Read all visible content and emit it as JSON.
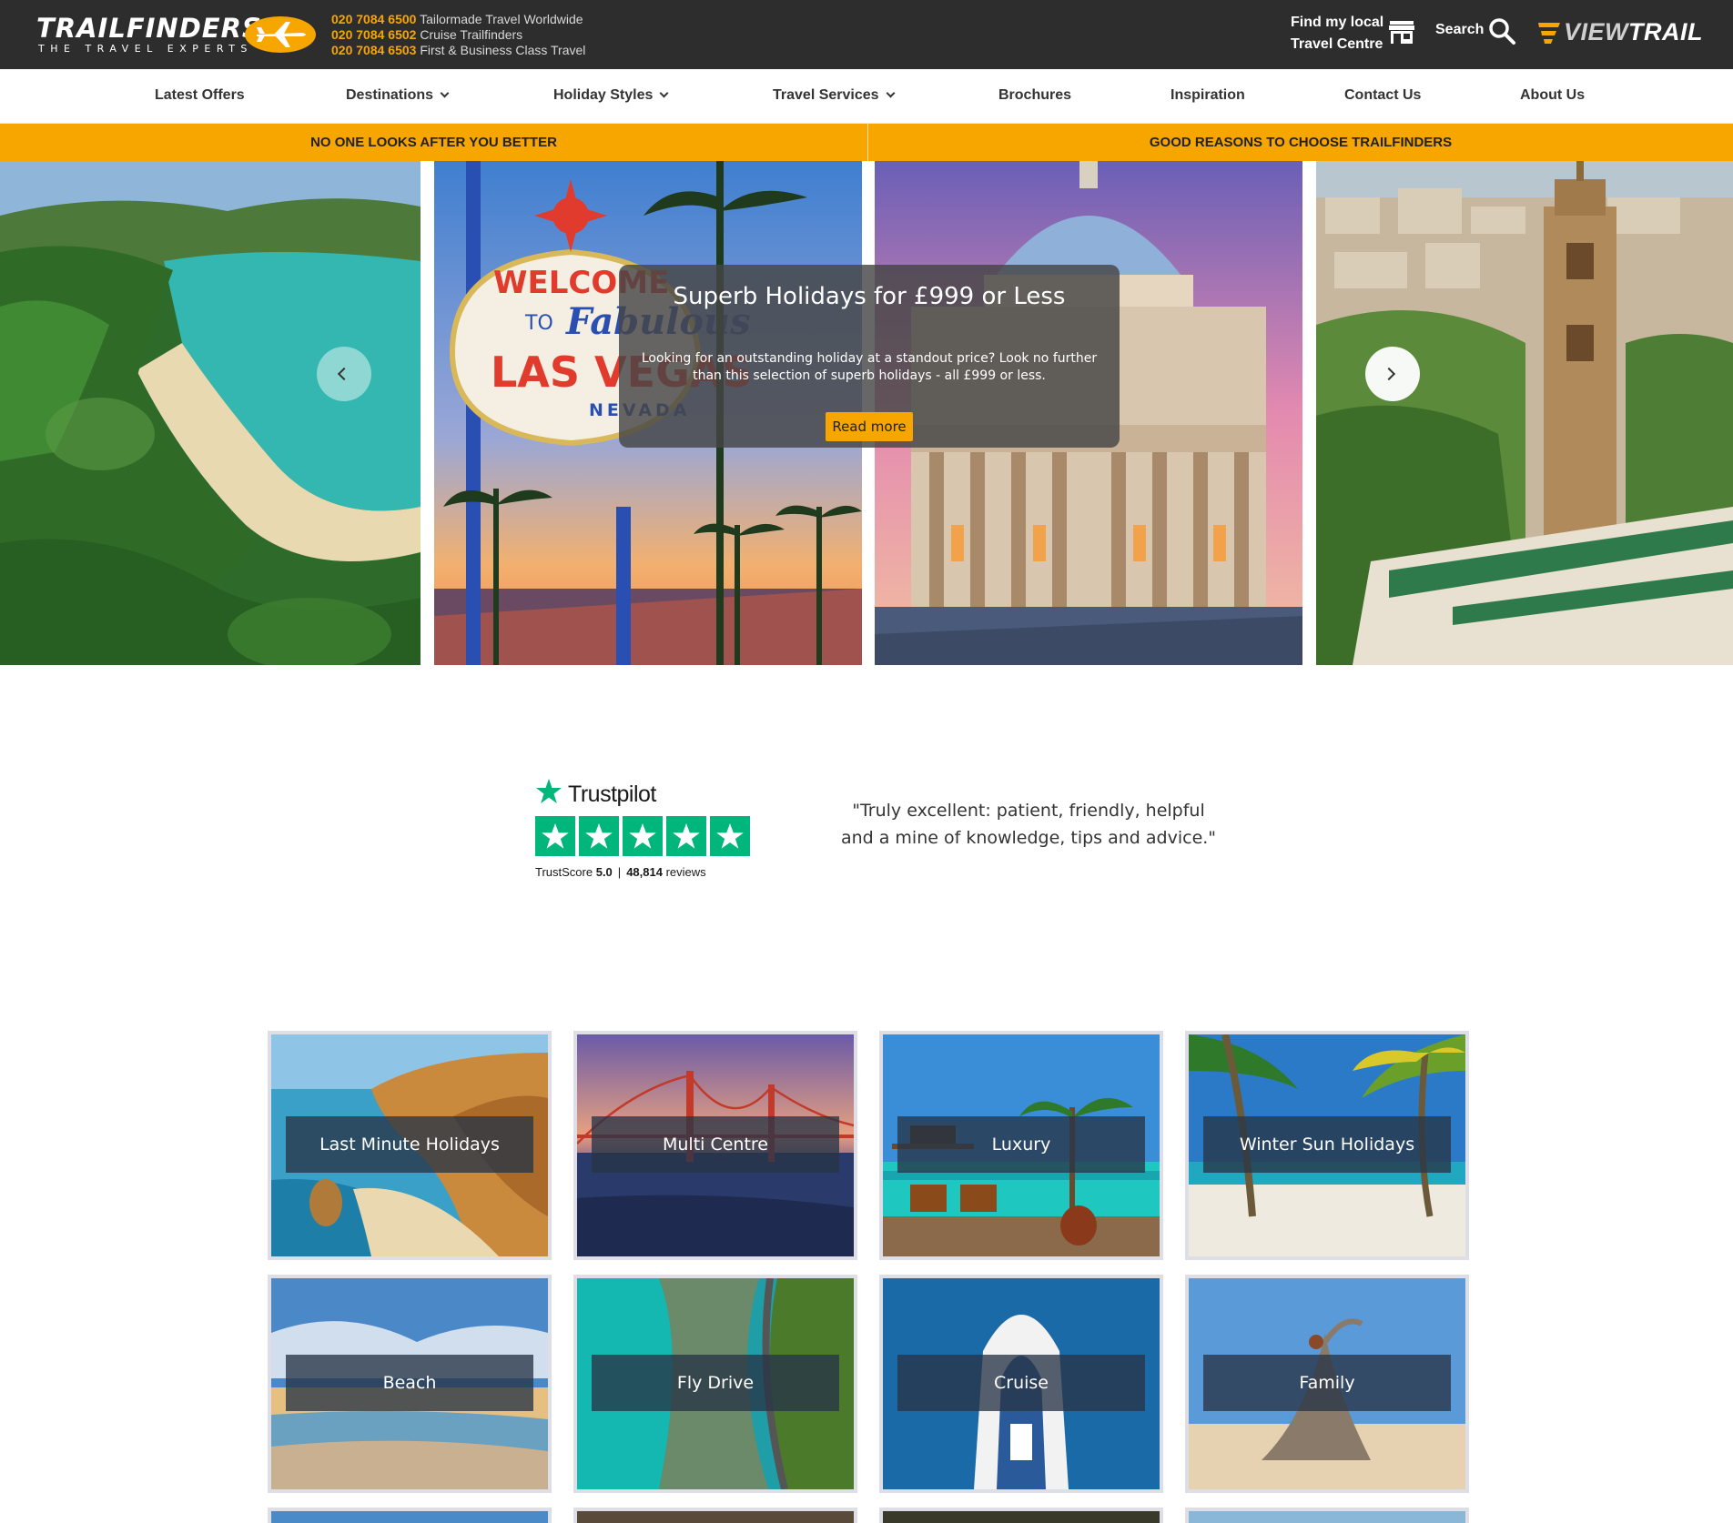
{
  "header": {
    "logo_word": "TRAILFINDERS",
    "logo_tagline": "THE TRAVEL EXPERTS",
    "phones": [
      {
        "number": "020 7084 6500",
        "label": "Tailormade Travel Worldwide"
      },
      {
        "number": "020 7084 6502",
        "label": "Cruise Trailfinders"
      },
      {
        "number": "020 7084 6503",
        "label": "First & Business Class Travel"
      }
    ],
    "find_centre_line1": "Find my local",
    "find_centre_line2": "Travel Centre",
    "search_label": "Search",
    "viewtrail_v": "VIEW",
    "viewtrail_rest": "TRAIL"
  },
  "nav": {
    "items": [
      {
        "label": "Latest Offers",
        "dropdown": false
      },
      {
        "label": "Destinations",
        "dropdown": true
      },
      {
        "label": "Holiday Styles",
        "dropdown": true
      },
      {
        "label": "Travel Services",
        "dropdown": true
      },
      {
        "label": "Brochures",
        "dropdown": false
      },
      {
        "label": "Inspiration",
        "dropdown": false
      },
      {
        "label": "Contact Us",
        "dropdown": false
      },
      {
        "label": "About Us",
        "dropdown": false
      }
    ]
  },
  "banner": {
    "left": "NO ONE LOOKS AFTER YOU BETTER",
    "right": "GOOD REASONS TO CHOOSE TRAILFINDERS"
  },
  "hero": {
    "title": "Superb Holidays for £999 or Less",
    "text": "Looking for an outstanding holiday at a standout price? Look no further than this selection of superb holidays - all £999 or less.",
    "button": "Read more",
    "sign_welcome": "WELCOME",
    "sign_to": "TO",
    "sign_fabulous": "Fabulous",
    "sign_las_vegas": "LAS VEGAS",
    "sign_nevada": "NEVADA"
  },
  "trustpilot": {
    "brand": "Trustpilot",
    "score_label": "TrustScore",
    "score": "5.0",
    "reviews_count": "48,814",
    "reviews_label": "reviews",
    "stars": 5,
    "quote_line1": "\"Truly excellent: patient, friendly, helpful",
    "quote_line2": "and a mine of knowledge, tips and advice.\""
  },
  "tiles": [
    {
      "label": "Last Minute Holidays"
    },
    {
      "label": "Multi Centre"
    },
    {
      "label": "Luxury"
    },
    {
      "label": "Winter Sun Holidays"
    },
    {
      "label": "Beach"
    },
    {
      "label": "Fly Drive"
    },
    {
      "label": "Cruise"
    },
    {
      "label": "Family"
    }
  ],
  "colors": {
    "header_bg": "#2d2d2d",
    "accent_orange": "#f7a600",
    "trustpilot_green": "#00b67a",
    "tile_label_bg": "#283446"
  }
}
